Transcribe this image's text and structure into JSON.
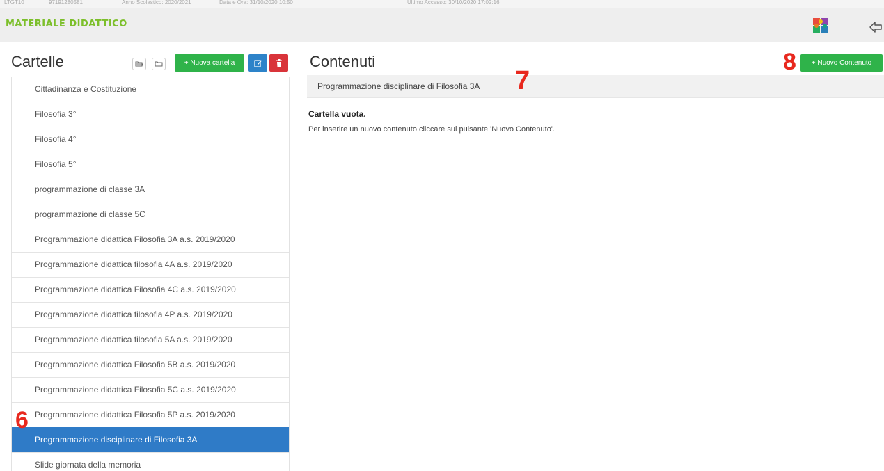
{
  "header_strip": {
    "code": "LTGT10",
    "number": "97191280581",
    "anno": "Anno Scolastico: 2020/2021",
    "data": "Data e Ora: 31/10/2020 10:50",
    "accesso": "Ultimo Accesso: 30/10/2020 17:02:16"
  },
  "module": {
    "title": "MATERIALE DIDATTICO",
    "app_icon": "puzzle-icon",
    "back_icon": "back-arrow-icon"
  },
  "left_panel": {
    "title": "Cartelle",
    "expand_icon": "folder-open-icon",
    "collapse_icon": "folder-icon",
    "new_folder_label": "+ Nuova cartella",
    "edit_icon": "edit-icon",
    "delete_icon": "trash-icon",
    "folders": [
      "Cittadinanza e Costituzione",
      "Filosofia 3°",
      "Filosofia 4°",
      "Filosofia 5°",
      "programmazione di classe 3A",
      "programmazione di classe 5C",
      "Programmazione didattica Filosofia 3A a.s. 2019/2020",
      "Programmazione didattica filosofia 4A a.s. 2019/2020",
      "Programmazione didattica Filosofia 4C a.s. 2019/2020",
      "Programmazione didattica filosofia 4P a.s. 2019/2020",
      "Programmazione didattica filosofia 5A a.s. 2019/2020",
      "Programmazione didattica Filosofia 5B a.s. 2019/2020",
      "Programmazione didattica Filosofia 5C a.s. 2019/2020",
      "Programmazione didattica Filosofia 5P a.s. 2019/2020",
      "Programmazione disciplinare di Filosofia 3A",
      "Slide giornata della memoria"
    ],
    "active_index": 14
  },
  "right_panel": {
    "title": "Contenuti",
    "new_content_label": "+ Nuovo Contenuto",
    "breadcrumb": "Programmazione disciplinare di Filosofia 3A",
    "empty_title": "Cartella vuota.",
    "empty_message": "Per inserire un nuovo contenuto cliccare sul pulsante 'Nuovo Contenuto'."
  },
  "annotations": {
    "n6": "6",
    "n7": "7",
    "n8": "8"
  },
  "colors": {
    "green": "#2fb34a",
    "blue": "#2d83c9",
    "red": "#d9343a",
    "title_green": "#7cbf2a",
    "annotation": "#e8281e"
  }
}
